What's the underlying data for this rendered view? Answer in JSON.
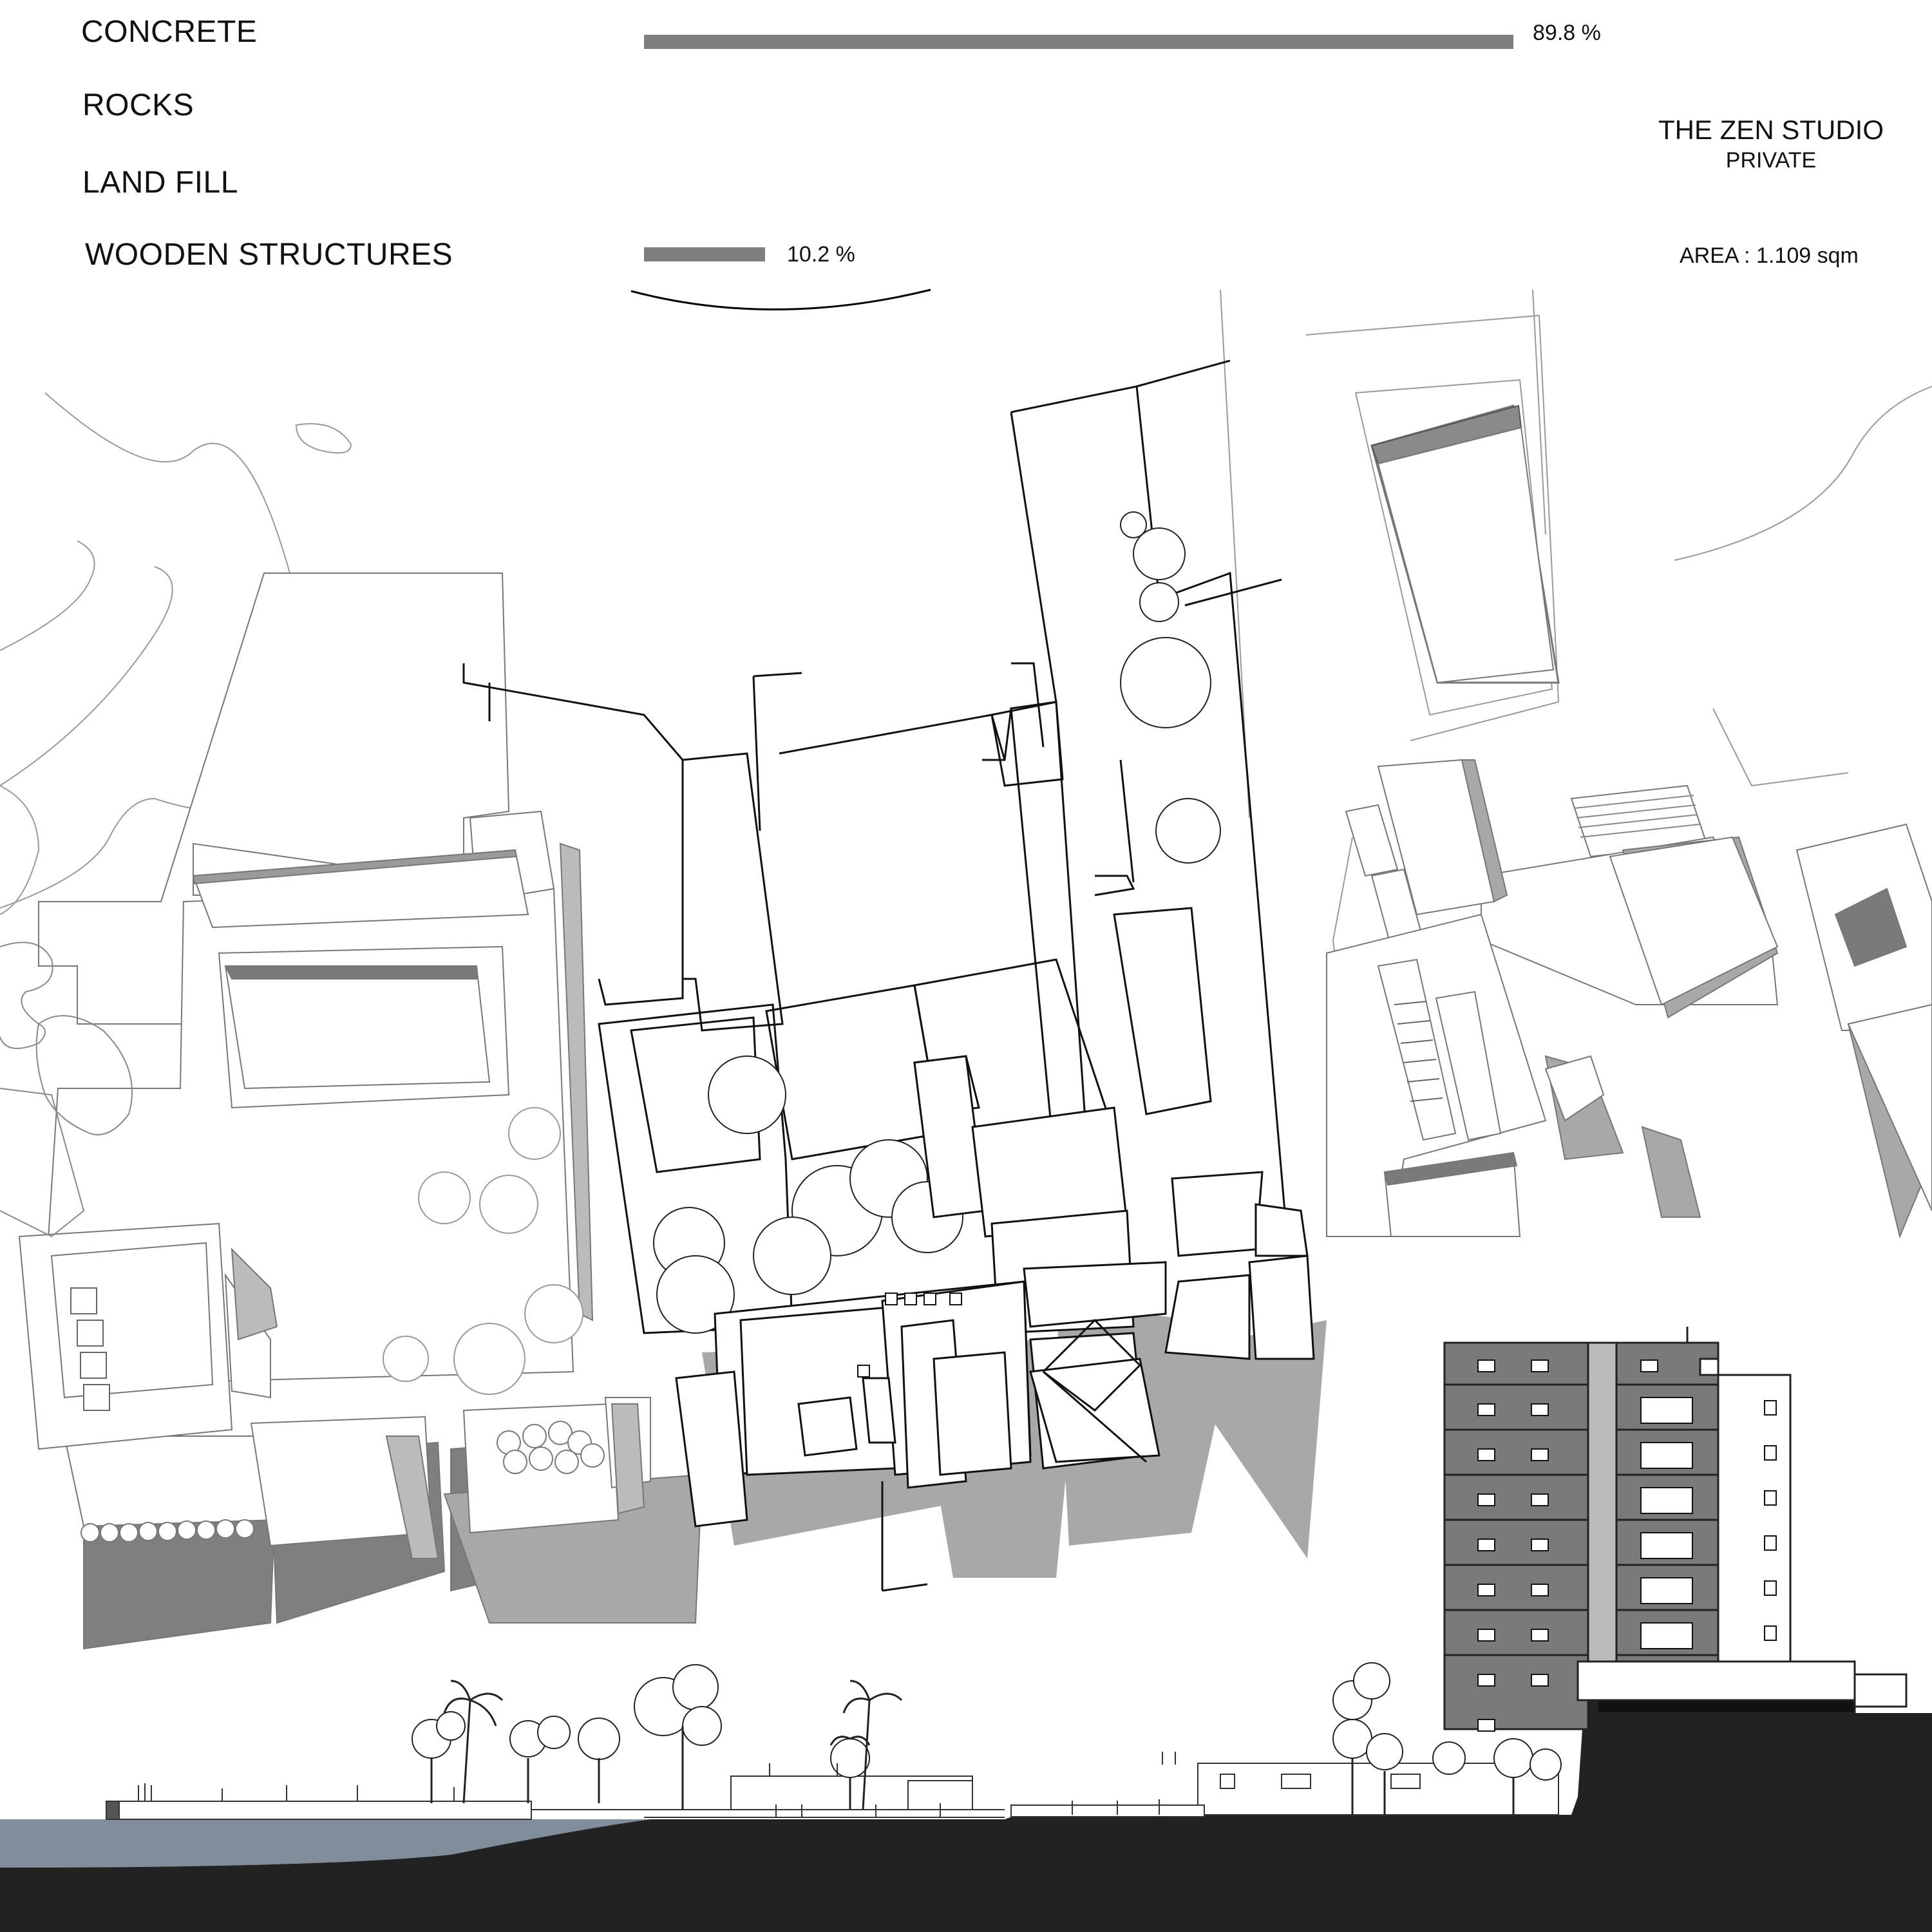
{
  "materials": [
    {
      "label": "CONCRETE",
      "percent": 89.8,
      "percent_label": "89.8 %"
    },
    {
      "label": "ROCKS"
    },
    {
      "label": "LAND FILL"
    },
    {
      "label": "WOODEN STRUCTURES",
      "percent": 10.2,
      "percent_label": "10.2 %"
    }
  ],
  "project": {
    "title": "THE ZEN STUDIO",
    "subtitle": "PRIVATE",
    "area": "AREA : 1.109 sqm"
  },
  "colors": {
    "bar": "#7f7f7f",
    "shadow": "#a8a8a8",
    "dark_shadow": "#7a7a7a",
    "ground": "#222222",
    "water": "#7f8e9a",
    "tower_dark": "#7a7a7a"
  }
}
